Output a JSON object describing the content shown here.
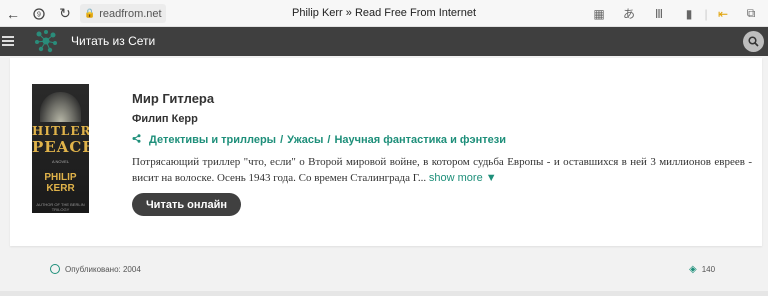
{
  "browser": {
    "url": "readfrom.net",
    "tab_title": "Philip Kerr » Read Free From Internet",
    "icons": [
      "back-icon",
      "shield-icon",
      "reload-icon",
      "lock-icon",
      "apps-icon",
      "translate-icon",
      "reader-icon",
      "bookmark-icon",
      "extension-icon"
    ]
  },
  "site": {
    "name": "Читать из Сети",
    "accent": "#1e8f7a",
    "header_bg": "#3f3f3f"
  },
  "book": {
    "title": "Мир Гитлера",
    "author": "Филип Керр",
    "genres": [
      "Детективы и триллеры",
      "Ужасы",
      "Научная фантастика и фэнтези"
    ],
    "genre_separator": "/",
    "description": "Потрясающий триллер \"что, если\" о Второй мировой войне, в котором судьба Европы - и оставшихся в ней 3 миллионов евреев - висит на волоске. Осень 1943 года. Со времен Сталинграда Г...",
    "show_more": "show more ▼",
    "read_button": "Читать онлайн",
    "cover": {
      "line1": "HITLER'S",
      "line2": "PEACE",
      "novel": "A NOVEL",
      "author_line1": "PHILIP",
      "author_line2": "KERR",
      "tagline": "AUTHOR OF THE BERLIN TRILOGY"
    }
  },
  "footer": {
    "published": "Опубликовано: 2004",
    "views": "140"
  }
}
